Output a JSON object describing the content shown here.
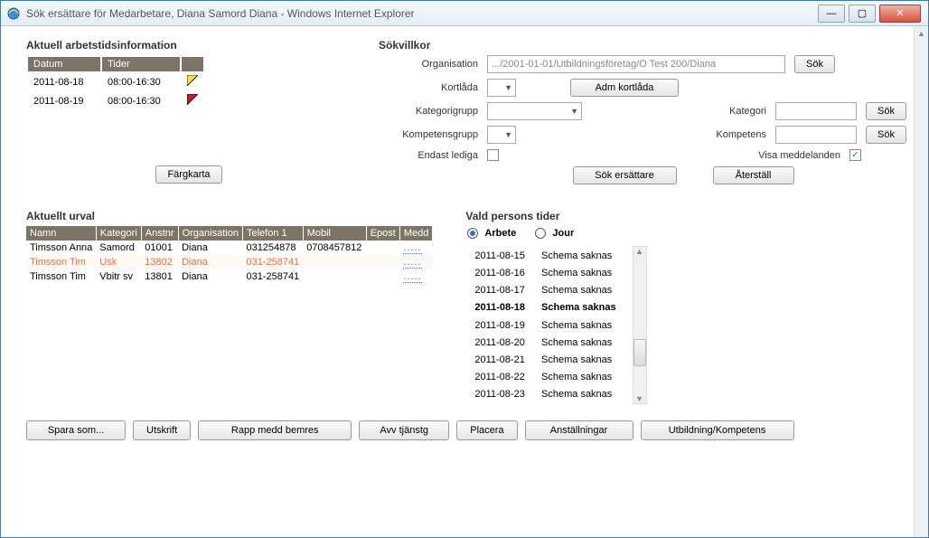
{
  "window": {
    "title": "Sök ersättare för  Medarbetare, Diana   Samord   Diana    -  Windows Internet Explorer"
  },
  "worktime": {
    "heading": "Aktuell arbetstidsinformation",
    "cols": {
      "date": "Datum",
      "times": "Tider"
    },
    "rows": [
      {
        "date": "2011-08-18",
        "times": "08:00-16:30",
        "flag": "yellow"
      },
      {
        "date": "2011-08-19",
        "times": "08:00-16:30",
        "flag": "red"
      }
    ],
    "colorbtn": "Färgkarta"
  },
  "sok": {
    "heading": "Sökvillkor",
    "labels": {
      "org": "Organisation",
      "kortlada": "Kortlåda",
      "kategorigrupp": "Kategorigrupp",
      "kategori": "Kategori",
      "kompetensgrupp": "Kompetensgrupp",
      "kompetens": "Kompetens",
      "endast": "Endast lediga",
      "visa": "Visa meddelanden"
    },
    "org_value": ".../2001-01-01/Utbildningsföretag/Ö Test 200/Diana",
    "buttons": {
      "sok": "Sök",
      "adm": "Adm kortlåda",
      "sokers": "Sök ersättare",
      "aterstall": "Återställ"
    }
  },
  "urval": {
    "heading": "Aktuellt urval",
    "cols": [
      "Namn",
      "Kategori",
      "Anstnr",
      "Organisation",
      "Telefon 1",
      "Mobil",
      "Epost",
      "Medd"
    ],
    "rows": [
      {
        "namn": "Timsson Anna",
        "kat": "Samord",
        "anst": "01001",
        "org": "Diana",
        "tel": "031254878",
        "mobil": "0708457812",
        "epost": "",
        "medd": "....."
      },
      {
        "namn": "Timsson Tim",
        "kat": "Usk",
        "anst": "13802",
        "org": "Diana",
        "tel": "031-258741",
        "mobil": "",
        "epost": "",
        "medd": ".....",
        "hl": true
      },
      {
        "namn": "Timsson Tim",
        "kat": "Vbitr sv",
        "anst": "13801",
        "org": "Diana",
        "tel": "031-258741",
        "mobil": "",
        "epost": "",
        "medd": "....."
      }
    ]
  },
  "vald": {
    "heading": "Vald persons tider",
    "radio": {
      "arbete": "Arbete",
      "jour": "Jour"
    },
    "rows": [
      {
        "d": "2011-08-15",
        "s": "Schema saknas"
      },
      {
        "d": "2011-08-16",
        "s": "Schema saknas"
      },
      {
        "d": "2011-08-17",
        "s": "Schema saknas"
      },
      {
        "d": "2011-08-18",
        "s": "Schema saknas",
        "bold": true
      },
      {
        "d": "2011-08-19",
        "s": "Schema saknas"
      },
      {
        "d": "2011-08-20",
        "s": "Schema saknas"
      },
      {
        "d": "2011-08-21",
        "s": "Schema saknas"
      },
      {
        "d": "2011-08-22",
        "s": "Schema saknas"
      },
      {
        "d": "2011-08-23",
        "s": "Schema saknas"
      }
    ]
  },
  "bottom": {
    "spara": "Spara som...",
    "utskrift": "Utskrift",
    "rapp": "Rapp medd bemres",
    "avv": "Avv tjänstg",
    "placera": "Placera",
    "anst": "Anställningar",
    "utb": "Utbildning/Kompetens"
  }
}
